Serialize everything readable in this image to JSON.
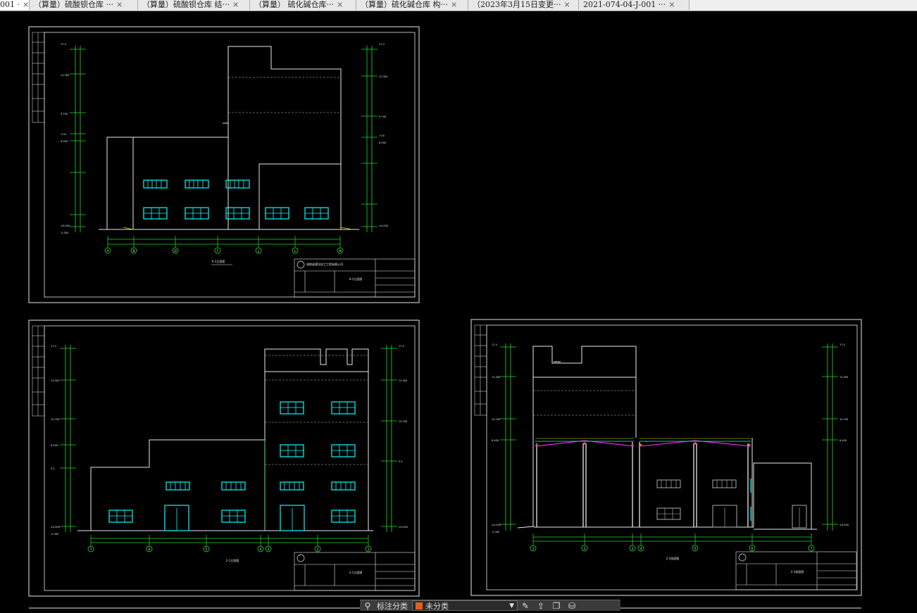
{
  "tabs": [
    {
      "label": "001 ·",
      "active": true
    },
    {
      "label": "（算量）硫酸钡仓库 ···"
    },
    {
      "label": "（算量）硫酸钡仓库 结···"
    },
    {
      "label": "（算量） 硫化碱仓库···"
    },
    {
      "label": "（算量）硫化碱仓库 构···"
    },
    {
      "label": "（2023年3月15日变更···"
    },
    {
      "label": "2021-074-04-J-001 ···"
    }
  ],
  "tab_close_glyph": "×",
  "drawings": {
    "top_left": {
      "title": "A-1立面图",
      "company": "湖南省建设化工工程有限公司",
      "block_title": "A-1立面图",
      "axis": [
        "A",
        "B",
        "D",
        "F",
        "J",
        "L",
        "N"
      ]
    },
    "bottom_left": {
      "title": "2-1立面图",
      "block_title": "2-1立面图",
      "axis": [
        "7",
        "6",
        "5",
        "4",
        "3",
        "2",
        "1"
      ]
    },
    "bottom_right": {
      "title": "2-2剖面图",
      "block_title": "2-2剖面图",
      "axis": [
        "1",
        "2",
        "3",
        "4",
        "5",
        "6",
        "7"
      ]
    }
  },
  "bottombar": {
    "label": "标注分类",
    "selected": "未分类",
    "swatch_color": "#e06020"
  },
  "colors": {
    "green": "#22dd22",
    "cyan": "#00ffff",
    "white": "#e8e8e8",
    "magenta": "#ff33ff",
    "yellow": "#e0e000"
  }
}
